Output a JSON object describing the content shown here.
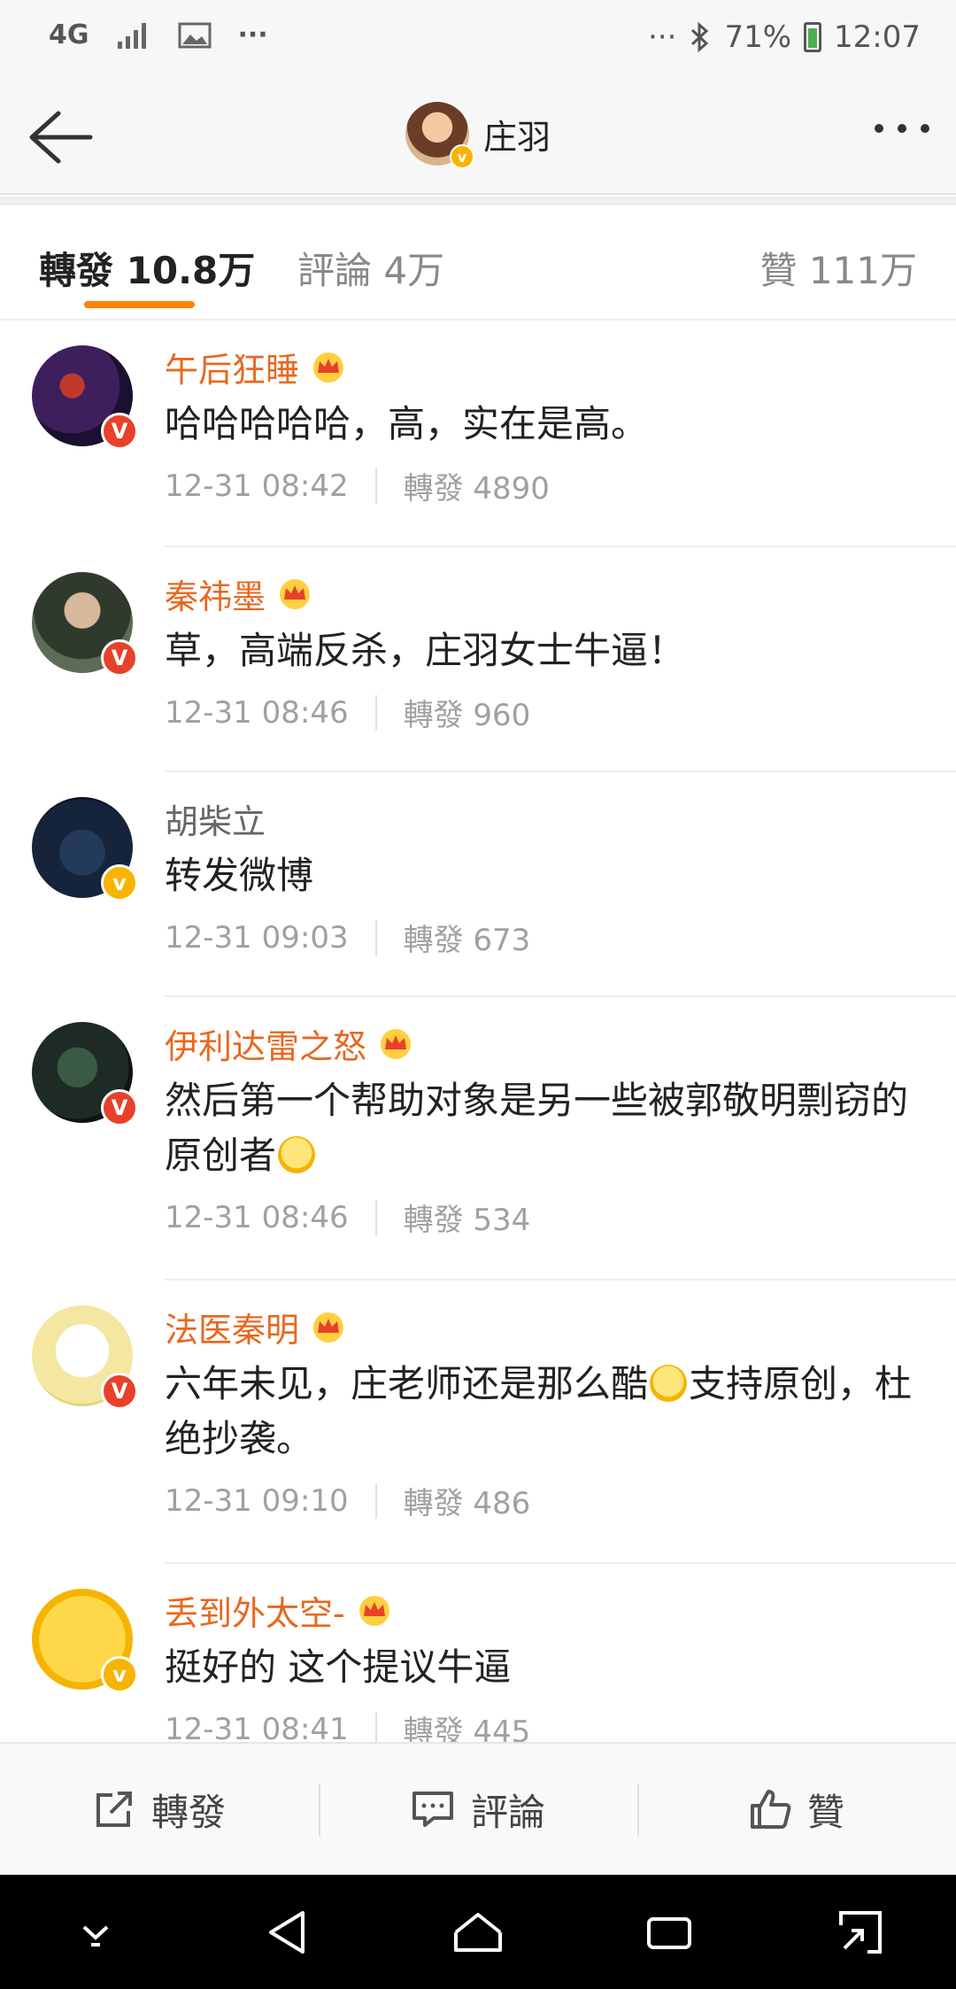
{
  "status_bar": {
    "network": "4G",
    "more": "···",
    "right_more": "···",
    "battery": "71%",
    "time": "12:07"
  },
  "header": {
    "title": "庄羽"
  },
  "tabs": [
    {
      "label": "轉發 10.8万"
    },
    {
      "label": "評論 4万"
    },
    {
      "label": "贊 111万"
    }
  ],
  "reposts": [
    {
      "name": "午后狂睡",
      "content": "哈哈哈哈哈，高，实在是高。",
      "time": "12-31 08:42",
      "repost_count": "轉發 4890",
      "badge": "red",
      "vip": true
    },
    {
      "name": "秦祎墨",
      "content": "草，高端反杀，庄羽女士牛逼！",
      "time": "12-31 08:46",
      "repost_count": "轉發 960",
      "badge": "red",
      "vip": true
    },
    {
      "name": "胡柴立",
      "content": "转发微博",
      "time": "12-31 09:03",
      "repost_count": "轉發 673",
      "badge": "yellow",
      "vip": false
    },
    {
      "name": "伊利达雷之怒",
      "content": "然后第一个帮助对象是另一些被郭敬明剽窃的原创者",
      "time": "12-31 08:46",
      "repost_count": "轉發 534",
      "badge": "red",
      "vip": true
    },
    {
      "name": "法医秦明",
      "content_a": "六年未见，庄老师还是那么酷",
      "content_b": "支持原创，杜绝抄袭。",
      "time": "12-31 09:10",
      "repost_count": "轉發 486",
      "badge": "red",
      "vip": true
    },
    {
      "name": "丢到外太空-",
      "content": "挺好的 这个提议牛逼",
      "time": "12-31 08:41",
      "repost_count": "轉發 445",
      "badge": "yellow",
      "vip": true
    }
  ],
  "actions": {
    "repost": "轉發",
    "comment": "評論",
    "like": "贊"
  },
  "colors": {
    "accent": "#ff8200",
    "vip_name": "#e8681f",
    "badge_red": "#e8412a",
    "badge_yellow": "#f7b400"
  }
}
